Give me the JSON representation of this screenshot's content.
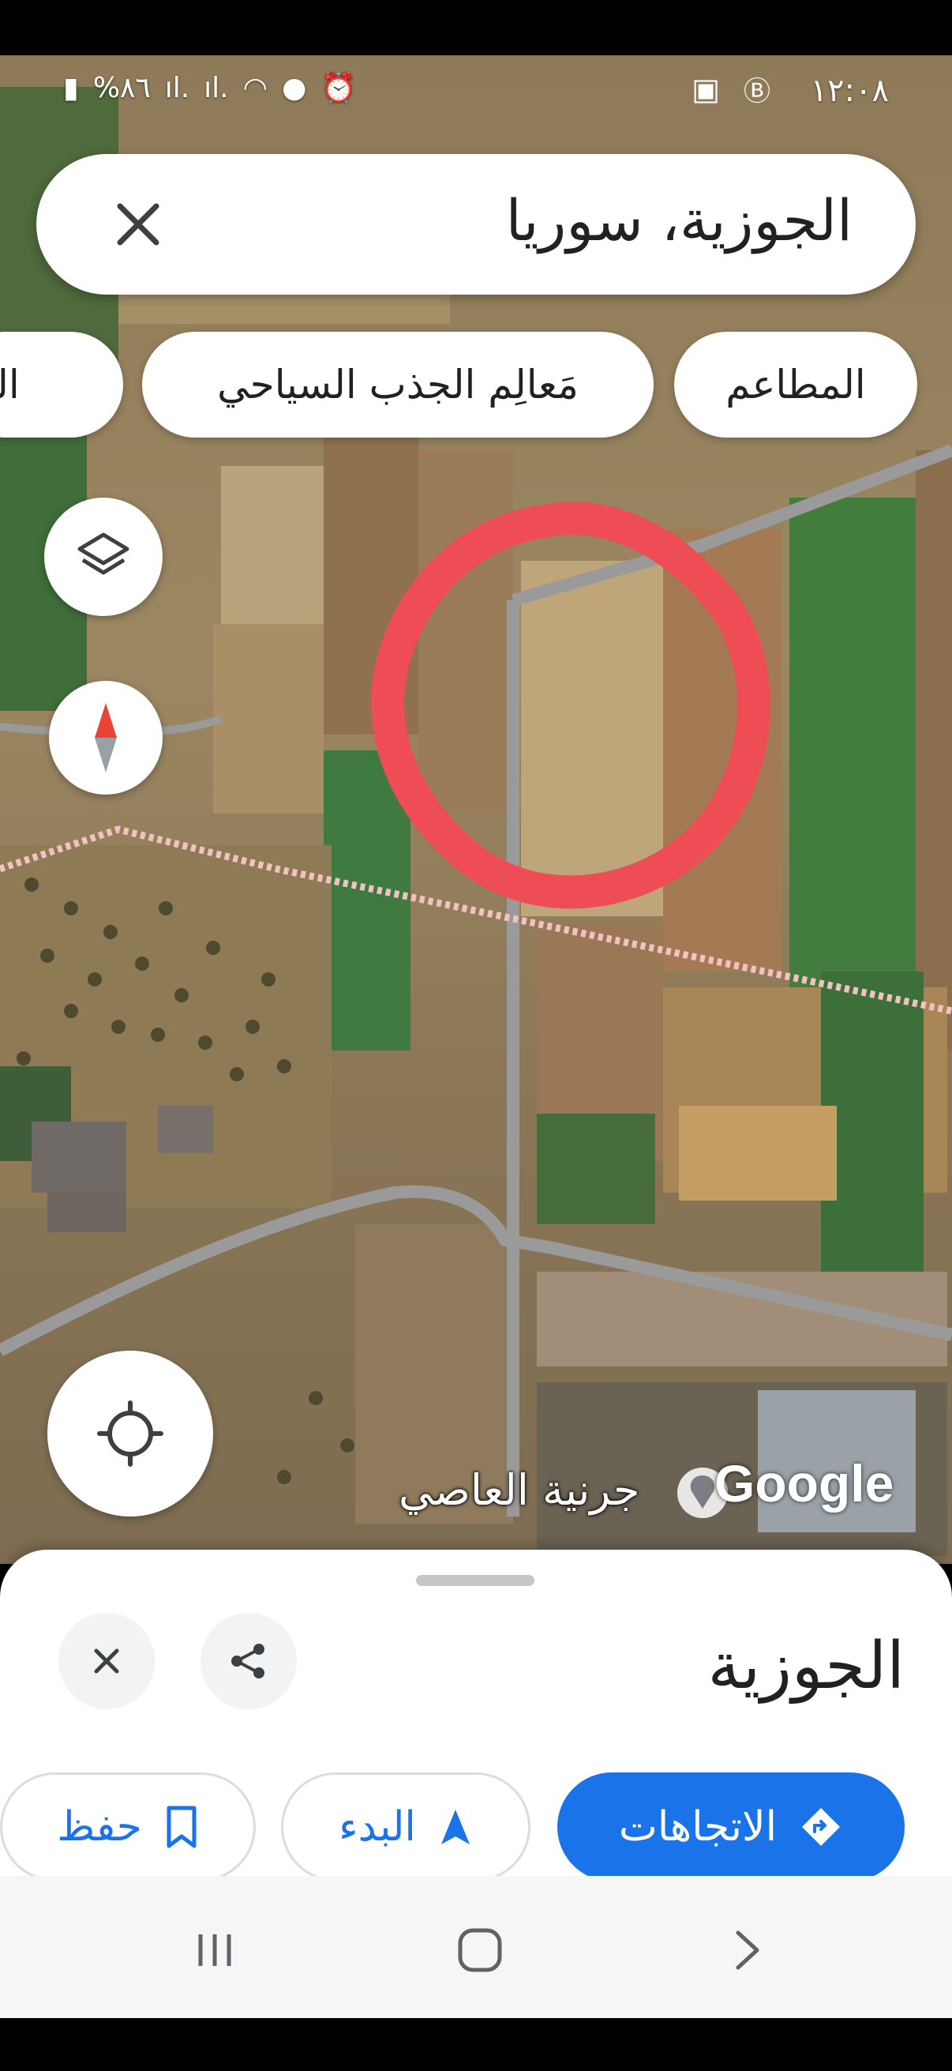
{
  "status_bar": {
    "time": "١٢:٠٨",
    "battery": "%٨٦"
  },
  "search": {
    "query": "الجوزية، سوريا"
  },
  "chips": [
    {
      "label": "المطاعم"
    },
    {
      "label": "مَعالِم الجذب السياحي"
    },
    {
      "label": "الفنا"
    }
  ],
  "map": {
    "place_label": "جرنية العاصي",
    "logo_text": "Google"
  },
  "sheet": {
    "title": "الجوزية",
    "actions": {
      "directions": "الاتجاهات",
      "start": "البدء",
      "save": "حفظ"
    }
  },
  "colors": {
    "accent": "#1a73e8",
    "circle_marker": "#ef4d55"
  },
  "icons": [
    "close-icon",
    "layers-icon",
    "compass-icon",
    "my-location-icon",
    "share-icon",
    "directions-icon",
    "navigation-icon",
    "bookmark-icon"
  ]
}
